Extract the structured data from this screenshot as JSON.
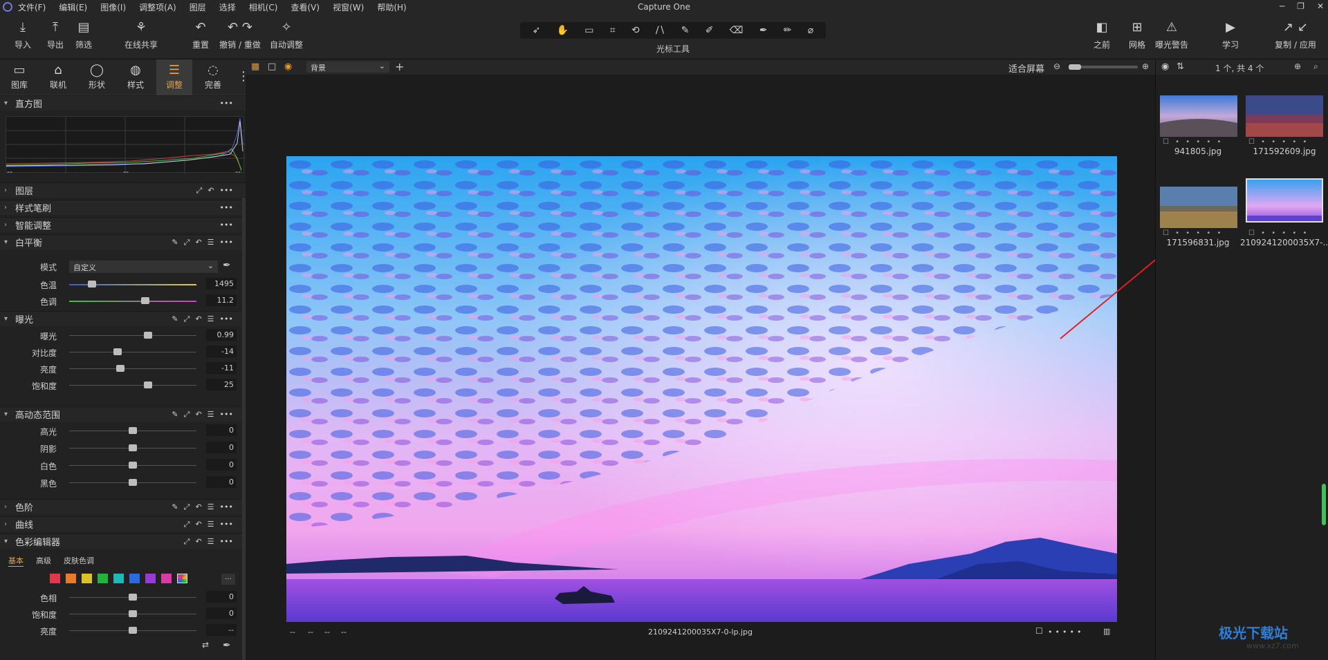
{
  "app": {
    "title": "Capture One"
  },
  "menu": [
    "文件(F)",
    "编辑(E)",
    "图像(I)",
    "调整项(A)",
    "图层",
    "选择",
    "相机(C)",
    "查看(V)",
    "视窗(W)",
    "帮助(H)"
  ],
  "toolbar": {
    "import": "导入",
    "export": "导出",
    "filter": "筛选",
    "share": "在线共享",
    "reset": "重置",
    "undo_redo": "撤销 / 重做",
    "auto": "自动调整",
    "cursor_tools": "光标工具",
    "before": "之前",
    "grid": "网格",
    "exposure_warn": "曝光警告",
    "learn": "学习",
    "copy_apply": "复制 / 应用"
  },
  "tool_tabs": [
    "图库",
    "联机",
    "形状",
    "样式",
    "调整",
    "完善"
  ],
  "histogram": {
    "title": "直方图",
    "readouts": [
      "--",
      "--",
      "--"
    ]
  },
  "sections": {
    "layers": "图层",
    "style_brush": "样式笔刷",
    "smart_adjust": "智能调整",
    "white_balance": "白平衡",
    "exposure": "曝光",
    "hdr": "高动态范围",
    "levels": "色阶",
    "curves": "曲线",
    "color_editor": "色彩编辑器"
  },
  "white_balance": {
    "mode_label": "模式",
    "mode_value": "自定义",
    "rows": [
      {
        "label": "色温",
        "value": "1495",
        "pos": 0.18
      },
      {
        "label": "色调",
        "value": "11.2",
        "pos": 0.6
      }
    ]
  },
  "exposure": {
    "rows": [
      {
        "label": "曝光",
        "value": "0.99",
        "pos": 0.62
      },
      {
        "label": "对比度",
        "value": "-14",
        "pos": 0.38
      },
      {
        "label": "亮度",
        "value": "-11",
        "pos": 0.4
      },
      {
        "label": "饱和度",
        "value": "25",
        "pos": 0.62
      }
    ]
  },
  "hdr": {
    "rows": [
      {
        "label": "高光",
        "value": "0",
        "pos": 0.5
      },
      {
        "label": "阴影",
        "value": "0",
        "pos": 0.5
      },
      {
        "label": "白色",
        "value": "0",
        "pos": 0.5
      },
      {
        "label": "黑色",
        "value": "0",
        "pos": 0.5
      }
    ]
  },
  "color_editor": {
    "tabs": [
      "基本",
      "高级",
      "皮肤色调"
    ],
    "swatches": [
      "#e0384a",
      "#e87b2a",
      "#d9c22a",
      "#22b33a",
      "#1fb8b8",
      "#2a6be0",
      "#9a3ad6",
      "#d93aa5"
    ],
    "more": "...",
    "rows": [
      {
        "label": "色相",
        "value": "0",
        "pos": 0.5
      },
      {
        "label": "饱和度",
        "value": "0",
        "pos": 0.5
      },
      {
        "label": "亮度",
        "value": "--",
        "pos": 0.5
      }
    ]
  },
  "viewer": {
    "layer_select": "背景",
    "fit_label": "适合屏幕",
    "filename": "2109241200035X7-0-lp.jpg",
    "readouts": [
      "--",
      "--",
      "--",
      "--"
    ]
  },
  "browser": {
    "count": "1 个, 共 4 个",
    "items": [
      {
        "name": "941805.jpg"
      },
      {
        "name": "171592609.jpg"
      },
      {
        "name": "171596831.jpg"
      },
      {
        "name": "2109241200035X7-..."
      }
    ]
  },
  "watermark": {
    "text": "极光下载站",
    "url": "www.xz7.com"
  }
}
